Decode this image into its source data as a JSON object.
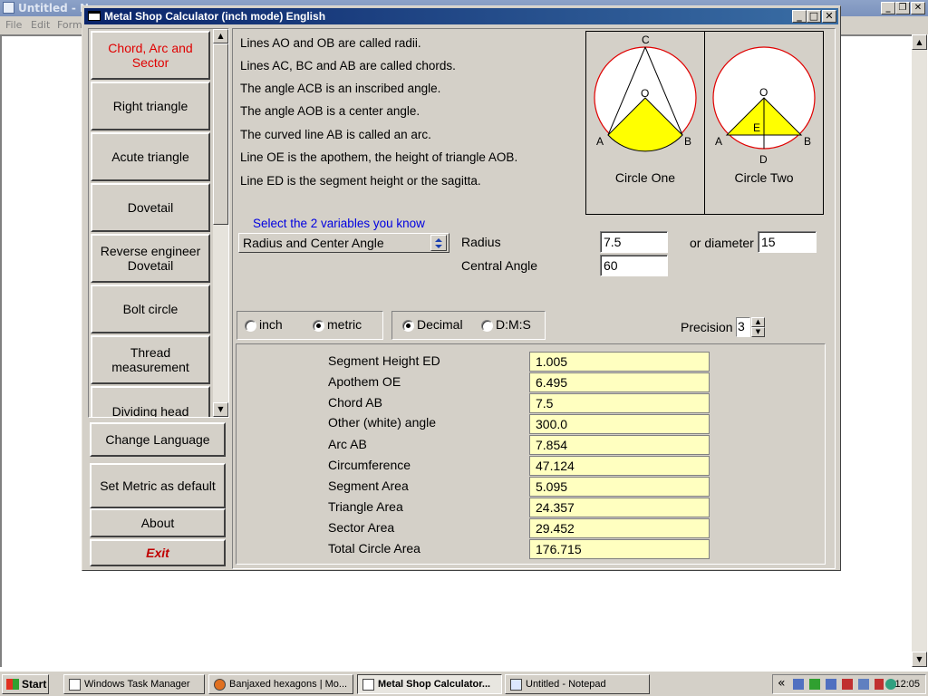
{
  "notepad": {
    "title": "Untitled - No",
    "menu": [
      "File",
      "Edit",
      "Forma"
    ]
  },
  "app": {
    "title": "Metal Shop Calculator (inch mode) English",
    "nav_items": [
      {
        "label": "Chord, Arc and Sector",
        "active": true
      },
      {
        "label": "Right triangle",
        "active": false
      },
      {
        "label": "Acute triangle",
        "active": false
      },
      {
        "label": "Dovetail",
        "active": false
      },
      {
        "label": "Reverse engineer Dovetail",
        "active": false
      },
      {
        "label": "Bolt circle",
        "active": false
      },
      {
        "label": "Thread measurement",
        "active": false
      },
      {
        "label": "Dividing head",
        "active": false
      }
    ],
    "buttons": {
      "change_language": "Change Language",
      "set_metric": "Set Metric as default",
      "about": "About",
      "exit": "Exit"
    },
    "descriptions": [
      "Lines AO and OB are called radii.",
      "Lines AC, BC and AB are called chords.",
      "The angle ACB is an inscribed angle.",
      "The angle AOB is a center angle.",
      "The curved line AB is called an arc.",
      "Line OE is the apothem, the height of triangle AOB.",
      "Line ED is the segment height or the sagitta."
    ],
    "diagram": {
      "circle_one_caption": "Circle One",
      "circle_two_caption": "Circle Two",
      "labels": {
        "c": "C",
        "o": "O",
        "a": "A",
        "b": "B",
        "e": "E",
        "d": "D"
      }
    },
    "inputs": {
      "hint": "Select the 2 variables you know",
      "selected_mode": "Radius and Center Angle",
      "radius_label": "Radius",
      "radius_value": "7.5",
      "diameter_label": "or diameter",
      "diameter_value": "15",
      "angle_label": "Central Angle",
      "angle_value": "60"
    },
    "units": {
      "inch": "inch",
      "metric": "metric",
      "selected": "metric"
    },
    "format": {
      "decimal": "Decimal",
      "dms": "D:M:S",
      "selected": "decimal"
    },
    "precision": {
      "label": "Precision",
      "value": "3"
    },
    "results": [
      {
        "label": "Segment Height ED",
        "value": "1.005"
      },
      {
        "label": "Apothem OE",
        "value": "6.495"
      },
      {
        "label": "Chord AB",
        "value": "7.5"
      },
      {
        "label": "Other (white) angle",
        "value": "300.0"
      },
      {
        "label": "Arc AB",
        "value": "7.854"
      },
      {
        "label": "Circumference",
        "value": "47.124"
      },
      {
        "label": "Segment Area",
        "value": "5.095"
      },
      {
        "label": "Triangle Area",
        "value": "24.357"
      },
      {
        "label": "Sector Area",
        "value": "29.452"
      },
      {
        "label": "Total Circle Area",
        "value": "176.715"
      }
    ]
  },
  "taskbar": {
    "start": "Start",
    "tasks": [
      {
        "label": "Windows Task Manager",
        "active": false
      },
      {
        "label": "Banjaxed hexagons | Mo...",
        "active": false
      },
      {
        "label": "Metal Shop Calculator...",
        "active": true
      },
      {
        "label": "Untitled - Notepad",
        "active": false
      }
    ],
    "tray_chevron": "«",
    "clock": "12:05"
  },
  "colors": {
    "active_nav": "#e00000",
    "hint": "#0000e0",
    "result_bg": "#ffffc0",
    "diagram_fill": "#ffff00",
    "circle_stroke": "#e00000",
    "title_bar": "#0a246a"
  }
}
